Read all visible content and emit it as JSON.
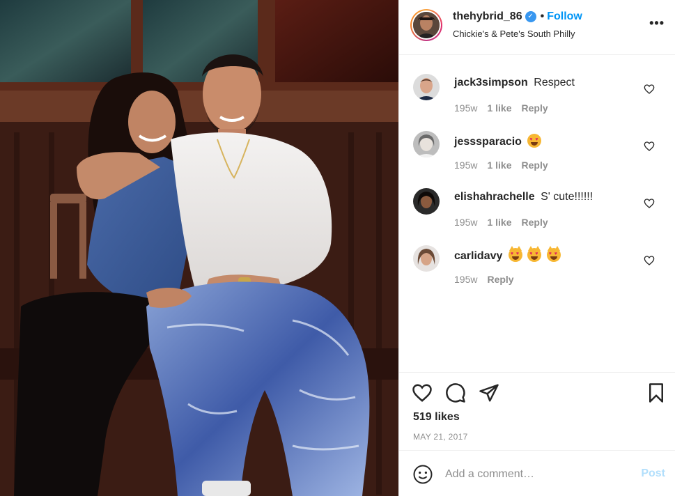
{
  "post": {
    "username": "thehybrid_86",
    "verified_icon": "verified-badge-icon",
    "separator": "•",
    "follow_label": "Follow",
    "location": "Chickie's & Pete's South Philly",
    "more_icon": "more-options-icon",
    "photo_description": "couple-portrait"
  },
  "comments": [
    {
      "user": "jack3simpson",
      "text": "Respect",
      "time": "195w",
      "likes": "1 like",
      "reply": "Reply"
    },
    {
      "user": "jesssparacio",
      "text": "",
      "emoji": [
        "heart-eyes-face"
      ],
      "time": "195w",
      "likes": "1 like",
      "reply": "Reply"
    },
    {
      "user": "elishahrachelle",
      "text": "S' cute!!!!!!",
      "time": "195w",
      "likes": "1 like",
      "reply": "Reply"
    },
    {
      "user": "carlidavy",
      "text": "",
      "emoji": [
        "heart-eyes-cat",
        "heart-eyes-cat",
        "heart-eyes-cat"
      ],
      "time": "195w",
      "reply": "Reply"
    }
  ],
  "actions": {
    "like_icon": "heart-outline-icon",
    "comment_icon": "comment-bubble-icon",
    "share_icon": "paper-plane-icon",
    "save_icon": "bookmark-icon",
    "likes_count": "519 likes",
    "date": "MAY 21, 2017"
  },
  "add_comment": {
    "emoji_icon": "smiley-icon",
    "placeholder": "Add a comment…",
    "post_label": "Post"
  },
  "colors": {
    "accent": "#0095f6",
    "post_disabled": "#b2dffc",
    "muted_text": "#8e8e8e",
    "verified": "#3897f0"
  }
}
